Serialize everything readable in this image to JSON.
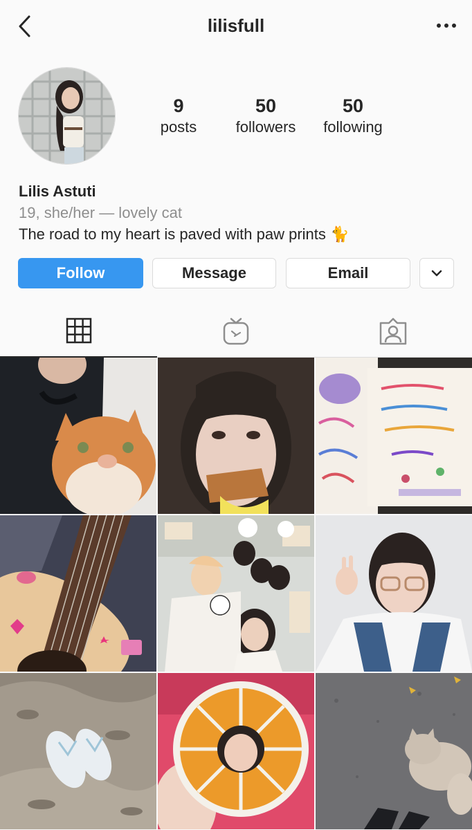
{
  "header": {
    "username": "lilisfull",
    "back_icon": "chevron-left-icon",
    "more_icon": "more-horizontal-icon"
  },
  "stats": [
    {
      "count": "9",
      "label": "posts"
    },
    {
      "count": "50",
      "label": "followers"
    },
    {
      "count": "50",
      "label": "following"
    }
  ],
  "bio": {
    "name": "Lilis Astuti",
    "subtitle": "19, she/her — lovely cat",
    "description": "The road to my heart is paved with paw prints 🐈"
  },
  "actions": {
    "follow": "Follow",
    "message": "Message",
    "email": "Email"
  },
  "tabs": [
    "grid-icon",
    "igtv-icon",
    "tagged-icon"
  ],
  "colors": {
    "accent": "#3797f0",
    "text": "#262626",
    "muted": "#8e8e8e",
    "border": "#dbdbdb",
    "background": "#fafafa"
  },
  "posts": [
    "photo-person-with-orange-cat",
    "photo-selfie-eating-pastry",
    "photo-handwritten-notebook",
    "photo-acoustic-guitar-with-stickers",
    "photo-group-selfie-in-store",
    "photo-girl-with-glasses-peace-sign",
    "photo-flip-flops-on-sand",
    "photo-dried-orange-slice-face",
    "photo-cat-on-pavement"
  ]
}
